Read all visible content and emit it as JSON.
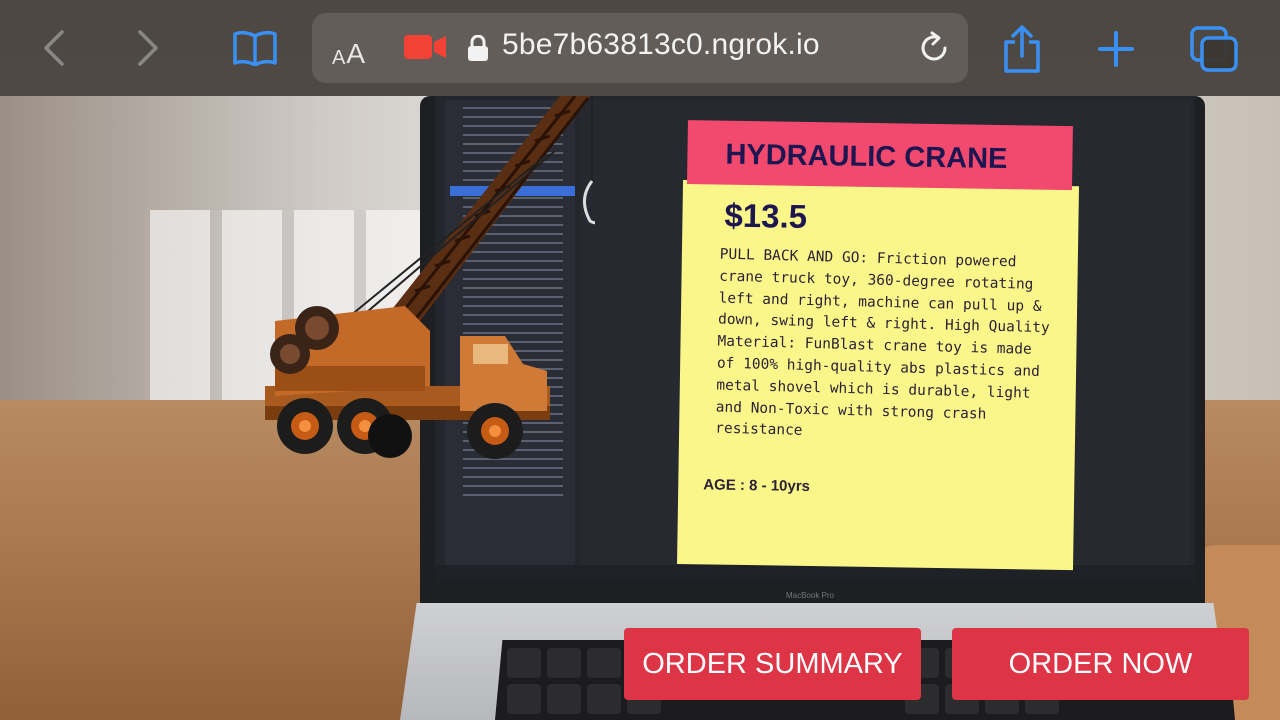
{
  "browser": {
    "text_size_label_small": "A",
    "text_size_label_big": "A",
    "url": "5be7b63813c0.ngrok.io",
    "icons": [
      "back-icon",
      "forward-icon",
      "bookmarks-icon",
      "camera-recording-icon",
      "lock-icon",
      "reload-icon",
      "share-icon",
      "new-tab-icon",
      "tabs-icon"
    ],
    "colors": {
      "accent": "#3a8ff5",
      "recording": "#f24236"
    }
  },
  "product_card": {
    "title": "HYDRAULIC CRANE",
    "price": "$13.5",
    "description": "PULL BACK AND GO: Friction powered crane truck toy, 360-degree rotating left and right, machine can pull up & down, swing left & right. High Quality Material: FunBlast crane toy is made of 100% high-quality abs plastics and metal shovel which is durable, light and Non-Toxic with strong crash resistance",
    "age": "AGE : 8 - 10yrs",
    "colors": {
      "header": "#f2496f",
      "body": "#fbf68a",
      "text": "#1e1650"
    }
  },
  "actions": {
    "order_summary_label": "ORDER SUMMARY",
    "order_now_label": "ORDER NOW",
    "color": "#dd3446"
  },
  "scene": {
    "laptop_label": "MacBook Pro"
  }
}
